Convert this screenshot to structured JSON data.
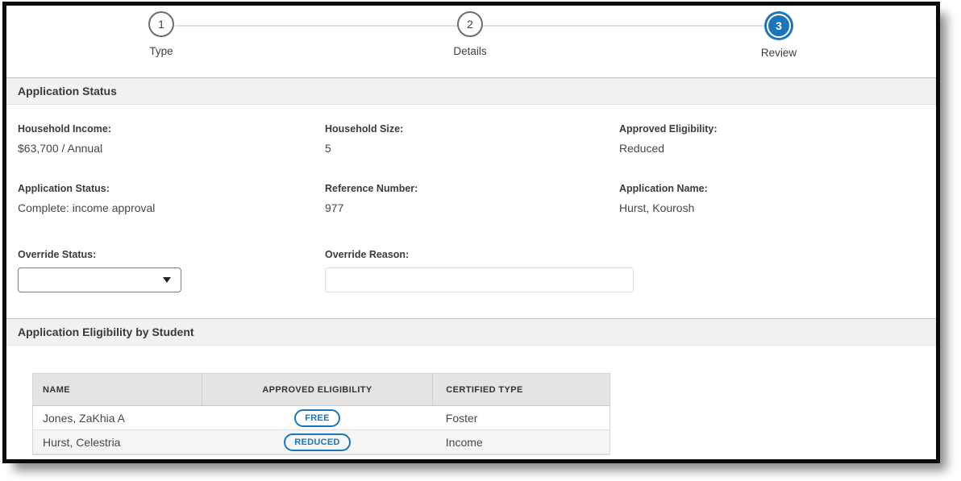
{
  "stepper": {
    "steps": [
      {
        "number": "1",
        "label": "Type"
      },
      {
        "number": "2",
        "label": "Details"
      },
      {
        "number": "3",
        "label": "Review"
      }
    ],
    "active_step": "3"
  },
  "application_status": {
    "title": "Application Status",
    "fields": [
      {
        "label": "Household Income:",
        "value": "$63,700 / Annual"
      },
      {
        "label": "Household Size:",
        "value": "5"
      },
      {
        "label": "Approved Eligibility:",
        "value": "Reduced"
      },
      {
        "label": "Application Status:",
        "value": "Complete: income approval"
      },
      {
        "label": "Reference Number:",
        "value": "977"
      },
      {
        "label": "Application Name:",
        "value": "Hurst, Kourosh"
      }
    ],
    "override_status": {
      "label": "Override Status:",
      "value": "",
      "icon": "dropdown-arrow"
    },
    "override_reason": {
      "label": "Override Reason:",
      "value": "",
      "placeholder": ""
    }
  },
  "eligibility_by_student": {
    "title": "Application Eligibility by Student",
    "table": {
      "headers": [
        "NAME",
        "APPROVED ELIGIBILITY",
        "CERTIFIED TYPE"
      ],
      "rows": [
        {
          "name": "Jones, ZaKhia A",
          "eligibility": "FREE",
          "certified_type": "Foster"
        },
        {
          "name": "Hurst, Celestria",
          "eligibility": "REDUCED",
          "certified_type": "Income"
        }
      ]
    }
  },
  "colors": {
    "accent_blue": "#1b75bb",
    "section_bar_bg": "#f1f1f1",
    "table_header_bg": "#e4e4e4"
  }
}
